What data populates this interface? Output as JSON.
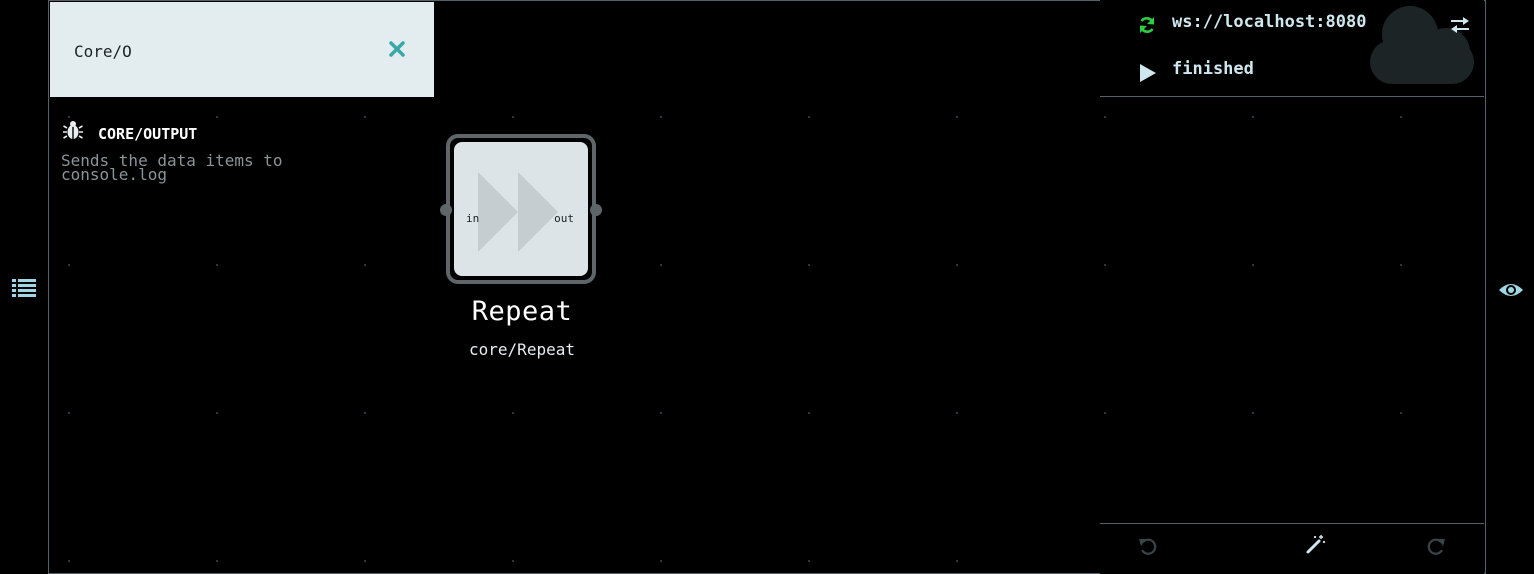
{
  "search": {
    "query": "Core/O"
  },
  "results": [
    {
      "title": "CORE/OUTPUT",
      "description": "Sends the data items to console.log",
      "icon": "bug-icon"
    }
  ],
  "node": {
    "title": "Repeat",
    "component": "core/Repeat",
    "icon": "fast-forward-icon",
    "inport": "in",
    "outport": "out"
  },
  "runtime": {
    "url": "ws://localhost:8080",
    "status": "finished",
    "status_icon": "play-icon",
    "connection_icon": "refresh-icon"
  },
  "colors": {
    "accent": "#3aa8a8",
    "connected": "#2ecc40",
    "panel_bg": "#e3ecef",
    "text_light": "#cfe7ee"
  }
}
